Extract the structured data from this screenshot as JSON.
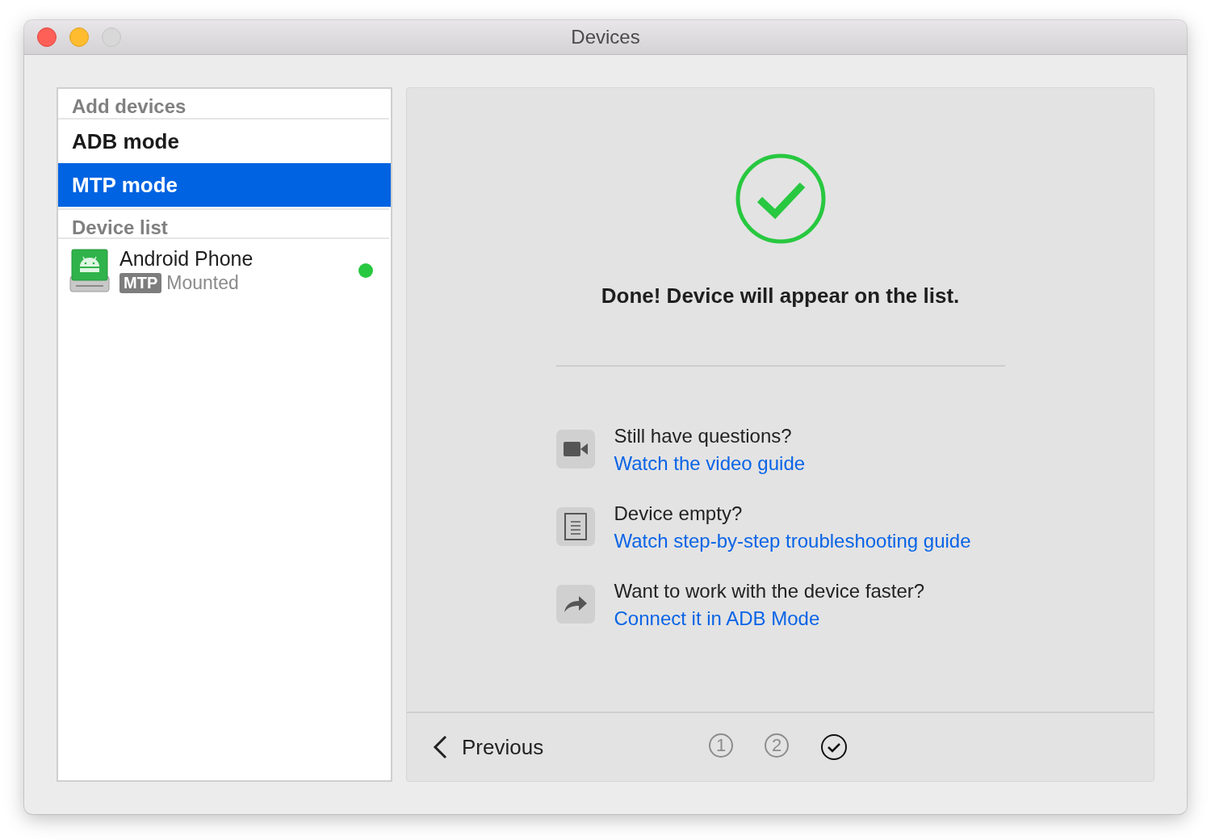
{
  "window": {
    "title": "Devices",
    "controls": [
      {
        "kind": "close"
      },
      {
        "kind": "minimize"
      },
      {
        "kind": "zoom",
        "disabled": true
      }
    ]
  },
  "sidebar": {
    "sections": [
      {
        "header": "Add devices",
        "items": [
          {
            "kind": "mode",
            "label": "ADB mode",
            "selected": false
          },
          {
            "kind": "mode",
            "label": "MTP mode",
            "selected": true
          }
        ]
      },
      {
        "header": "Device list",
        "items": [
          {
            "kind": "device",
            "label": "Android Phone",
            "badge": "MTP",
            "status": "Mounted",
            "color": "#28c840",
            "selected": false
          }
        ]
      }
    ]
  },
  "result": {
    "message": "Done! Device will appear on the list.",
    "success": true
  },
  "help": [
    {
      "kind": "video",
      "question": "Still have questions?",
      "link": "Watch the video guide"
    },
    {
      "kind": "document",
      "question": "Device empty?",
      "link": "Watch step-by-step troubleshooting guide"
    },
    {
      "kind": "share",
      "question": "Want to work with the device faster?",
      "link": "Connect it in ADB Mode"
    }
  ],
  "footer": {
    "back": "Previous",
    "steps": [
      {
        "kind": "number",
        "label": "1",
        "selected": false
      },
      {
        "kind": "number",
        "label": "2",
        "selected": false
      },
      {
        "kind": "done",
        "selected": true
      }
    ]
  }
}
